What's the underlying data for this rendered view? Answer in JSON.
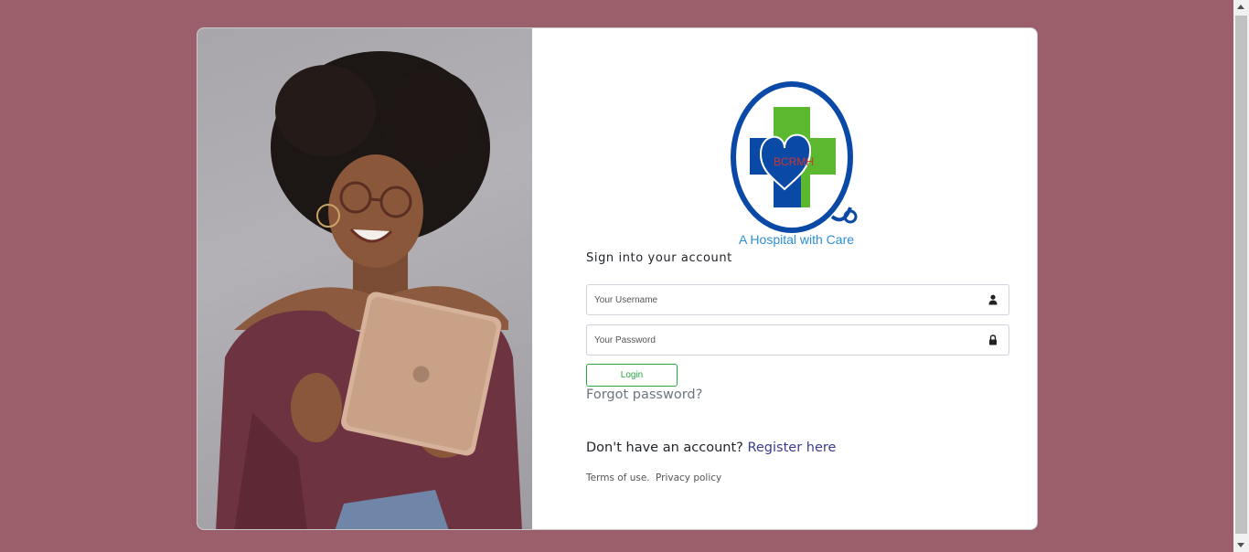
{
  "logo": {
    "initials": "BCRMH",
    "tagline": "A Hospital with Care",
    "colors": {
      "ring": "#0a4aa6",
      "cross_green": "#5cb82e",
      "cross_blue": "#0a4aa6",
      "initials": "#d0342c"
    }
  },
  "form": {
    "heading": "Sign into your account",
    "username": {
      "placeholder": "Your Username",
      "value": "",
      "icon": "user-icon"
    },
    "password": {
      "placeholder": "Your Password",
      "value": "",
      "icon": "lock-icon"
    },
    "login_label": "Login",
    "forgot_label": "Forgot password?"
  },
  "register": {
    "prompt": "Don't have an account?",
    "link_label": "Register here"
  },
  "footer": {
    "terms_label": "Terms of use.",
    "privacy_label": "Privacy policy"
  },
  "theme": {
    "page_bg": "#9b5e6b",
    "login_accent": "#28a745",
    "link_color": "#3b3b8f"
  },
  "photo": {
    "icon": "woman-with-tablet-photo"
  }
}
